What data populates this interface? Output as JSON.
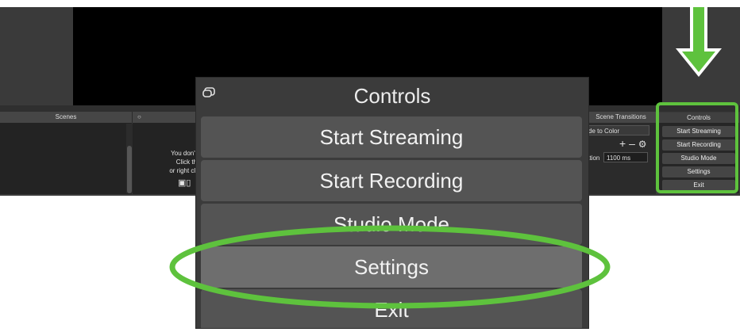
{
  "docks": {
    "scenes_header": "Scenes",
    "sources_text": [
      "You don't",
      "Click th",
      "or right cli"
    ],
    "transitions_header": "Scene Transitions",
    "transition_select": "de to Color",
    "duration_label": "ation",
    "duration_value": "1100 ms"
  },
  "controls_small": {
    "title": "Controls",
    "buttons": [
      "Start Streaming",
      "Start Recording",
      "Studio Mode",
      "Settings",
      "Exit"
    ]
  },
  "controls_big": {
    "title": "Controls",
    "buttons": [
      "Start Streaming",
      "Start Recording",
      "Studio Mode",
      "Settings",
      "Exit"
    ],
    "highlighted": "Settings"
  },
  "colors": {
    "highlight_green": "#5ec23d",
    "panel_bg": "#3b3b3b",
    "button_bg": "#545454"
  },
  "icons": [
    "float-icon",
    "plus-icon",
    "minus-icon",
    "gear-icon",
    "image-source-icon",
    "down-arrow-icon"
  ]
}
